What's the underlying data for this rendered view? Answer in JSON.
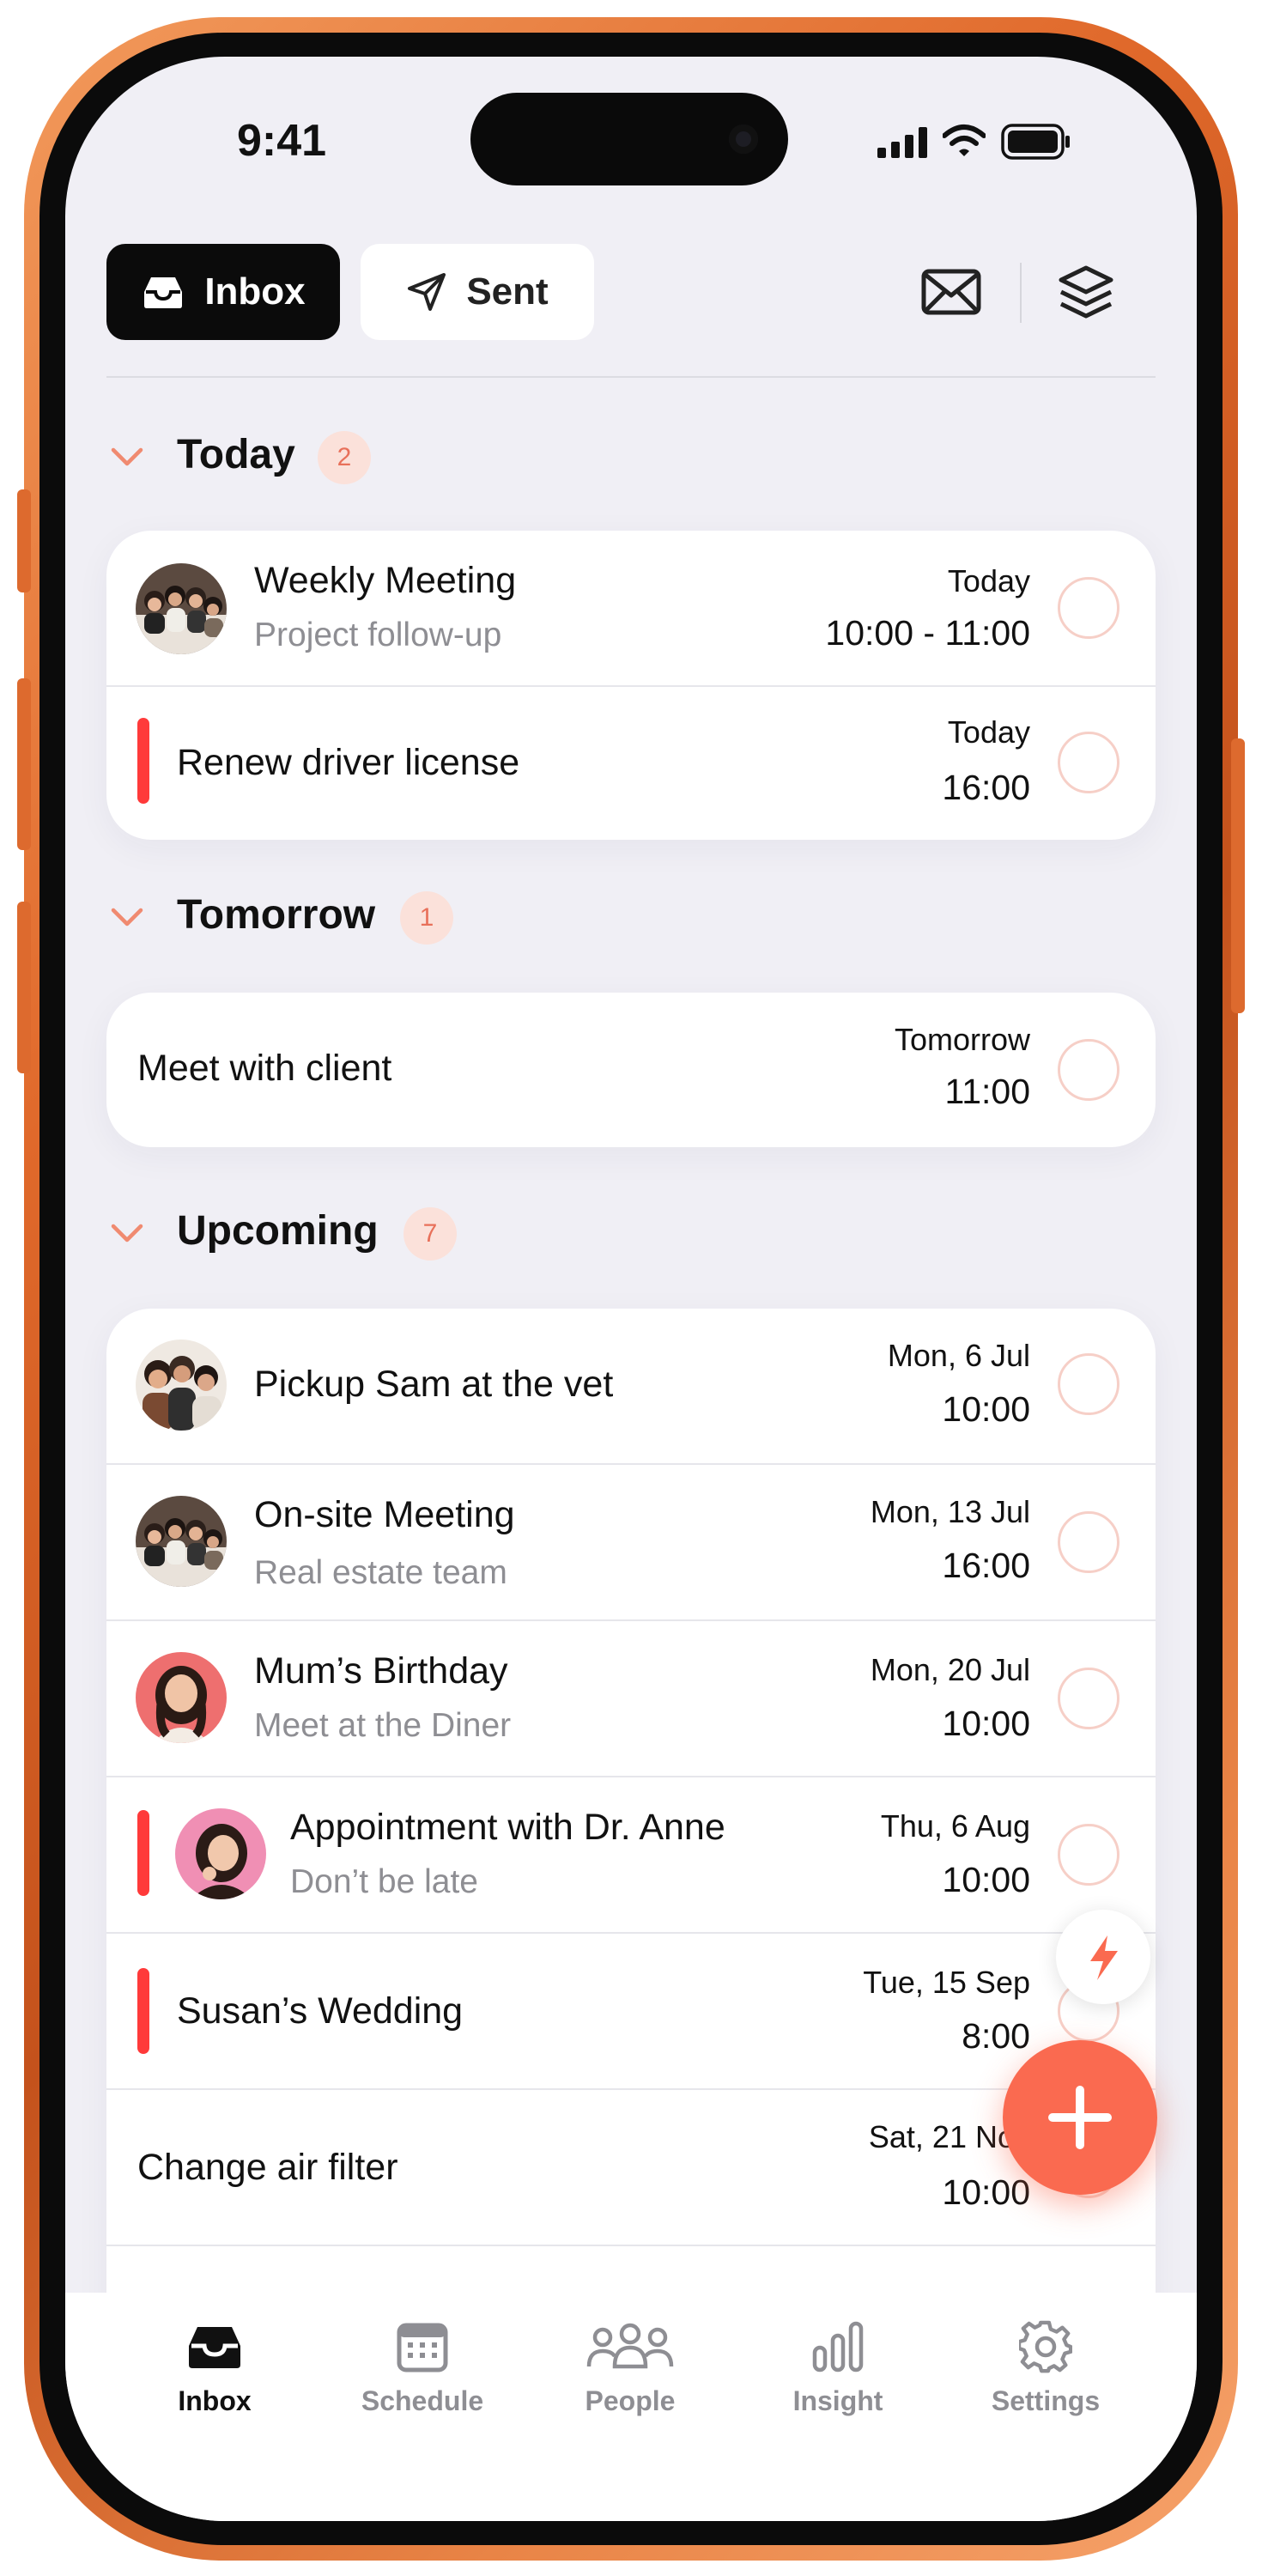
{
  "status_bar": {
    "time": "9:41"
  },
  "header": {
    "segments": [
      {
        "label": "Inbox",
        "icon": "inbox-tray-icon",
        "active": true
      },
      {
        "label": "Sent",
        "icon": "paper-plane-icon",
        "active": false
      }
    ],
    "actions": [
      {
        "icon": "mail-icon"
      },
      {
        "icon": "layers-icon"
      }
    ]
  },
  "sections": [
    {
      "title": "Today",
      "count": "2",
      "items": [
        {
          "title": "Weekly Meeting",
          "subtitle": "Project follow-up",
          "day": "Today",
          "time": "10:00 - 11:00",
          "avatar": "group-photo"
        },
        {
          "title": "Renew driver license",
          "day": "Today",
          "time": "16:00",
          "priority": true
        }
      ]
    },
    {
      "title": "Tomorrow",
      "count": "1",
      "items": [
        {
          "title": "Meet with client",
          "day": "Tomorrow",
          "time": "11:00"
        }
      ]
    },
    {
      "title": "Upcoming",
      "count": "7",
      "items": [
        {
          "title": "Pickup Sam at the vet",
          "day": "Mon, 6 Jul",
          "time": "10:00",
          "avatar": "family-photo"
        },
        {
          "title": "On-site Meeting",
          "subtitle": "Real estate team",
          "day": "Mon, 13 Jul",
          "time": "16:00",
          "avatar": "group-photo"
        },
        {
          "title": "Mum’s Birthday",
          "subtitle": "Meet at the Diner",
          "day": "Mon, 20 Jul",
          "time": "10:00",
          "avatar": "woman-portrait-red"
        },
        {
          "title": "Appointment with Dr. Anne",
          "subtitle": "Don’t be late",
          "day": "Thu, 6 Aug",
          "time": "10:00",
          "avatar": "woman-portrait-pink",
          "priority": true
        },
        {
          "title": "Susan’s Wedding",
          "day": "Tue, 15 Sep",
          "time": "8:00",
          "priority": true
        },
        {
          "title": "Change air filter",
          "day": "Sat, 21 Nov",
          "time": "10:00"
        }
      ]
    }
  ],
  "tabbar": {
    "tabs": [
      {
        "label": "Inbox",
        "icon": "inbox-tray-icon",
        "active": true
      },
      {
        "label": "Schedule",
        "icon": "calendar-icon",
        "active": false
      },
      {
        "label": "People",
        "icon": "people-icon",
        "active": false
      },
      {
        "label": "Insight",
        "icon": "bar-chart-icon",
        "active": false
      },
      {
        "label": "Settings",
        "icon": "gear-icon",
        "active": false
      }
    ]
  },
  "fab": {
    "icon": "plus-icon"
  },
  "quick_action": {
    "icon": "lightning-icon"
  },
  "colors": {
    "accent": "#fa6a50",
    "priority": "#ff3a3a",
    "badge_bg": "#fbe1da",
    "frame": "#e0692b"
  }
}
